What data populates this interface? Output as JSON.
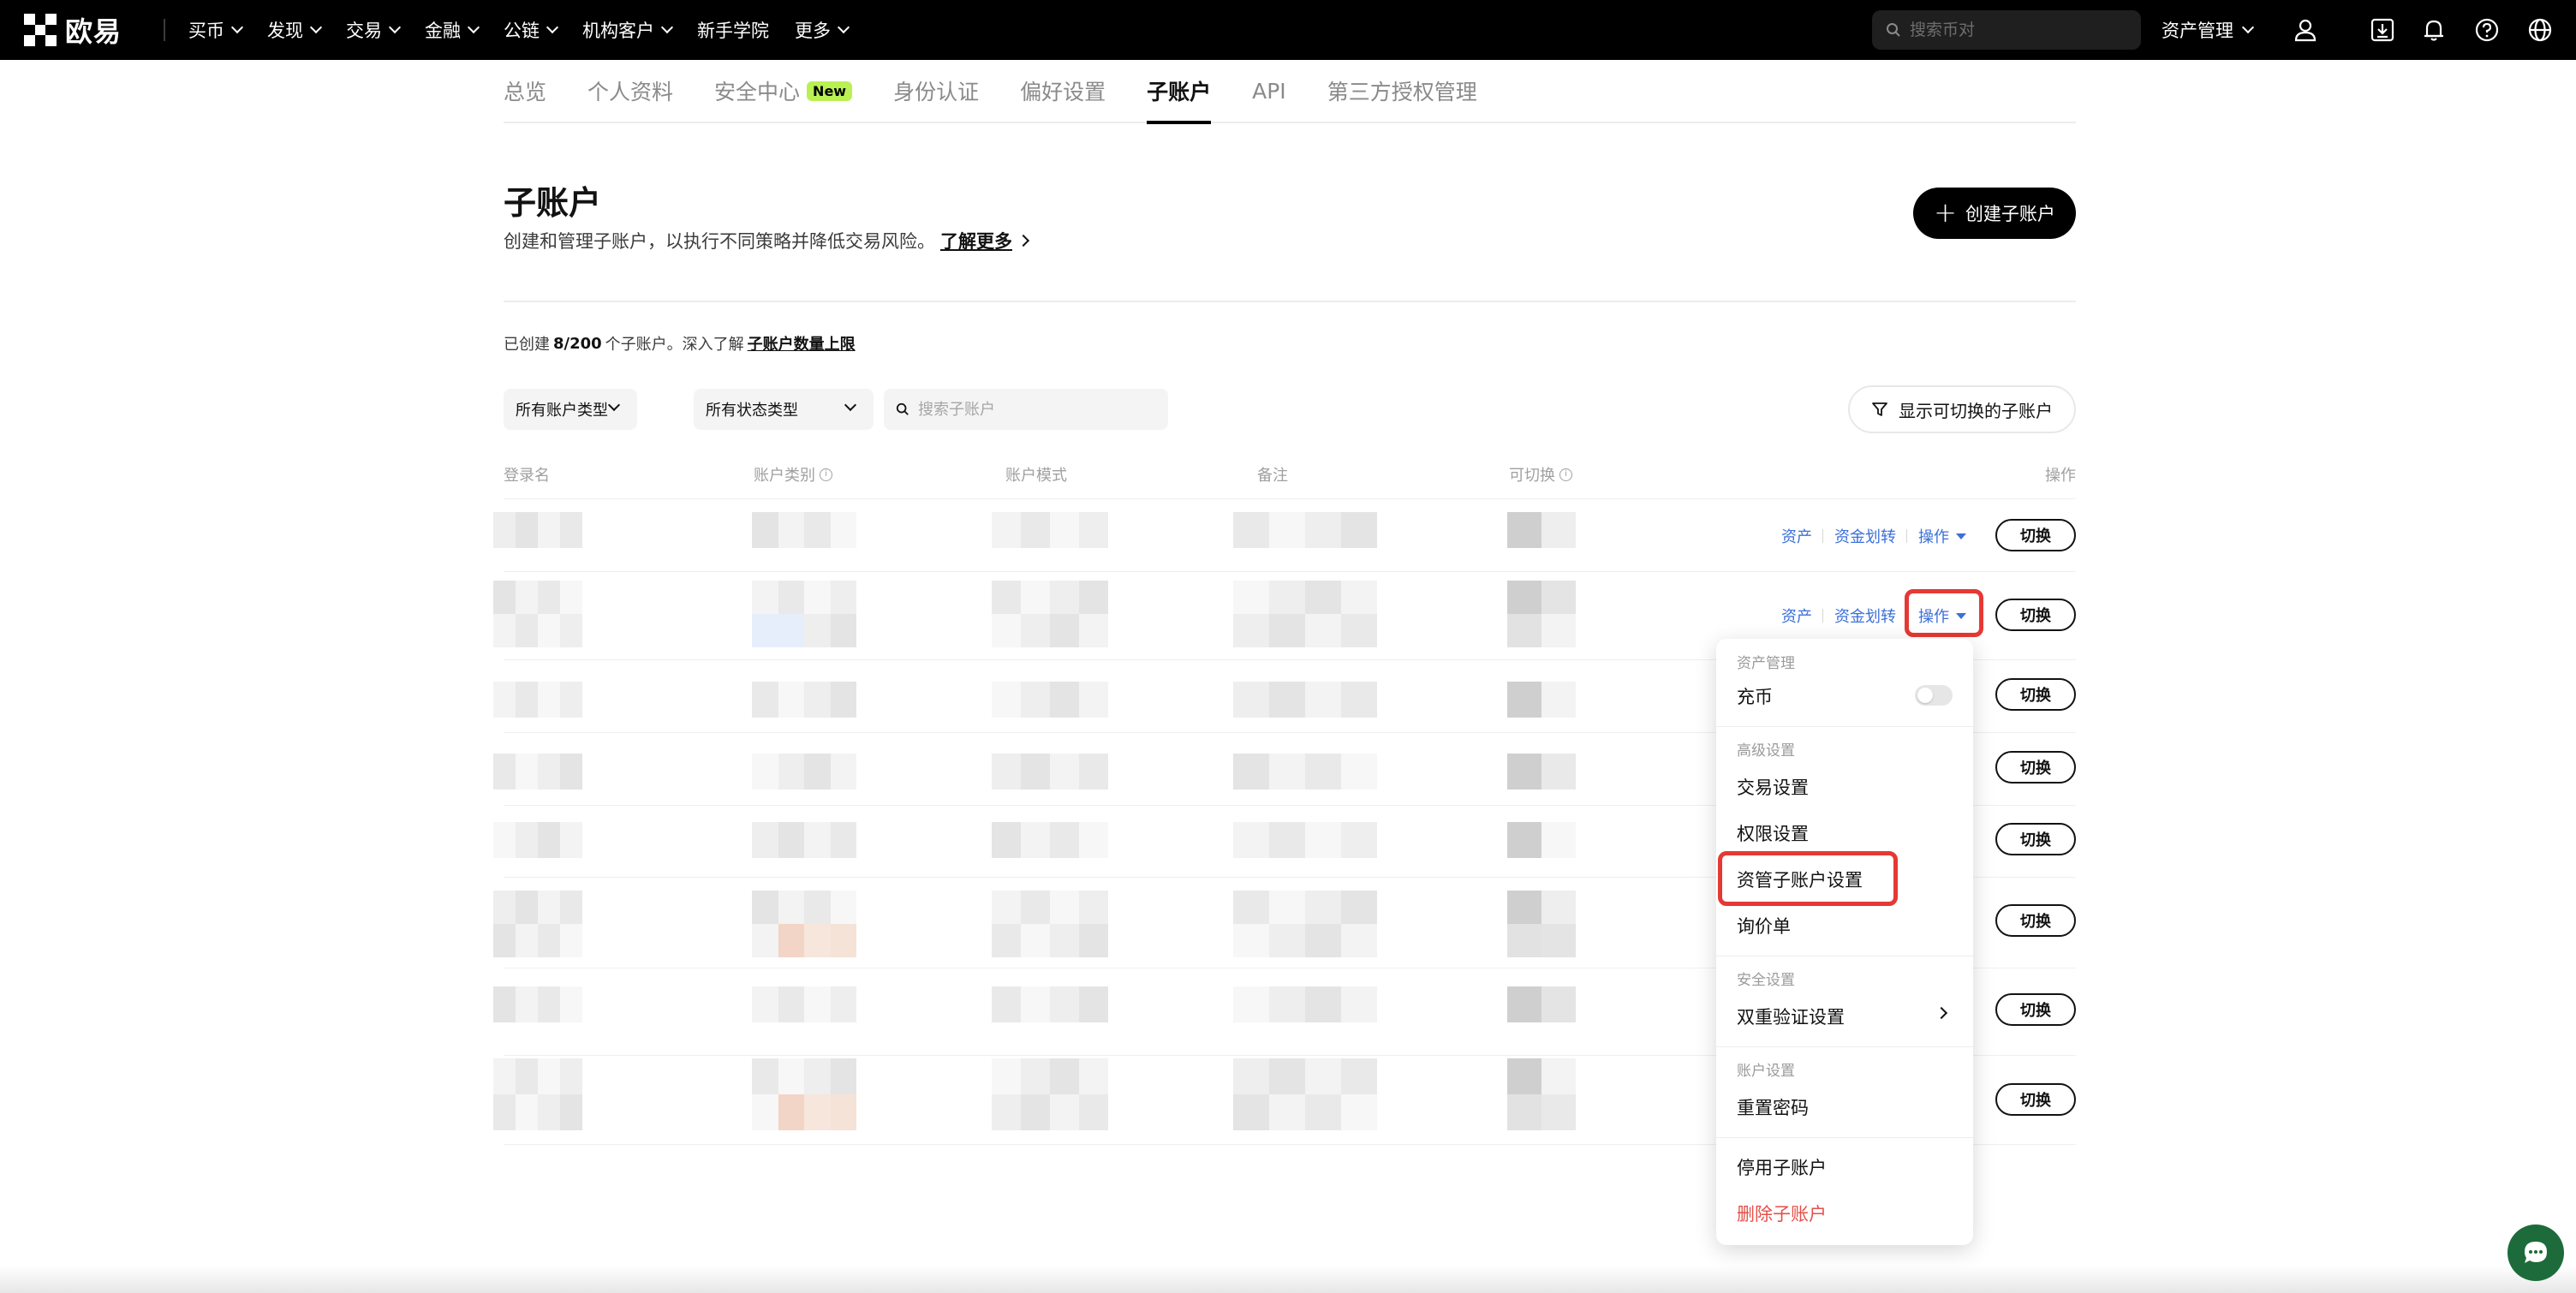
{
  "nav": {
    "brand": "欧易",
    "menu": [
      "买币",
      "发现",
      "交易",
      "金融",
      "公链",
      "机构客户",
      "新手学院",
      "更多"
    ],
    "menu_has_dropdown": [
      true,
      true,
      true,
      true,
      true,
      true,
      false,
      true
    ],
    "search_placeholder": "搜索币对",
    "asset_management": "资产管理",
    "icons": [
      "user-icon",
      "download-icon",
      "bell-icon",
      "help-icon",
      "globe-icon"
    ]
  },
  "tabs": {
    "items": [
      "总览",
      "个人资料",
      "安全中心",
      "身份认证",
      "偏好设置",
      "子账户",
      "API",
      "第三方授权管理"
    ],
    "new_badge": "New",
    "active": "子账户"
  },
  "header": {
    "title": "子账户",
    "description": "创建和管理子账户，以执行不同策略并降低交易风险。",
    "learn_more": "了解更多",
    "create_button": "创建子账户"
  },
  "summary": {
    "prefix": "已创建",
    "count": "8/200",
    "middle": "个子账户。深入了解",
    "link": "子账户数量上限"
  },
  "filters": {
    "account_type": "所有账户类型",
    "status_type": "所有状态类型",
    "search_placeholder": "搜索子账户",
    "switchable_button": "显示可切换的子账户"
  },
  "table": {
    "headers": {
      "login": "登录名",
      "account_type": "账户类别",
      "account_mode": "账户模式",
      "note": "备注",
      "switchable": "可切换",
      "actions": "操作"
    },
    "row_actions": {
      "assets": "资产",
      "transfer": "资金划转",
      "operate": "操作",
      "switch": "切换"
    },
    "row_count": 8
  },
  "dropdown": {
    "group_asset": "资产管理",
    "deposit": "充币",
    "deposit_enabled": false,
    "group_advanced": "高级设置",
    "trade_settings": "交易设置",
    "permission_settings": "权限设置",
    "managed_subaccount_settings": "资管子账户设置",
    "rfq": "询价单",
    "group_security": "安全设置",
    "two_factor": "双重验证设置",
    "group_account": "账户设置",
    "reset_password": "重置密码",
    "disable_subaccount": "停用子账户",
    "delete_subaccount": "删除子账户"
  },
  "colors": {
    "link_blue": "#3b6fd9",
    "danger_red": "#e5504a",
    "highlight_red": "#e53935",
    "badge_green": "#b9f154",
    "chat_green": "#1d6b3a"
  }
}
